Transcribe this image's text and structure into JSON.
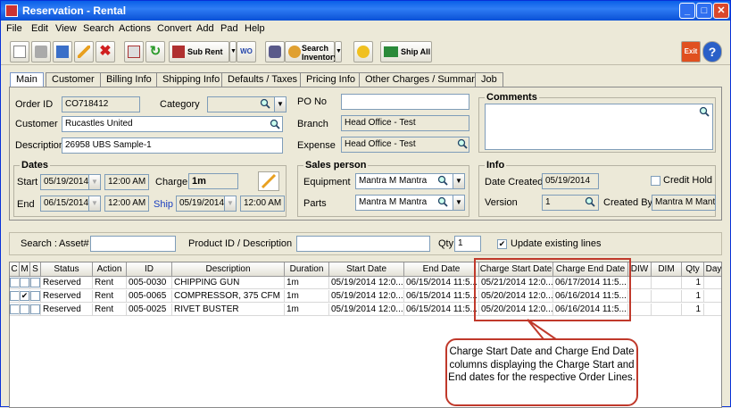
{
  "window": {
    "title": "Reservation - Rental"
  },
  "menu": [
    "File",
    "Edit",
    "View",
    "Search",
    "Actions",
    "Convert",
    "Add",
    "Pad",
    "Help"
  ],
  "toolbar": {
    "sub_rent": "Sub Rent",
    "wo": "WO",
    "search_inventory_1": "Search",
    "search_inventory_2": "Inventory",
    "ship_all": "Ship All",
    "exit": "Exit"
  },
  "tabs": [
    "Main",
    "Customer",
    "Billing Info",
    "Shipping Info",
    "Defaults / Taxes",
    "Pricing Info",
    "Other Charges / Summary",
    "Job"
  ],
  "main": {
    "order_id_label": "Order ID",
    "order_id": "CO718412",
    "category_label": "Category",
    "category": "",
    "customer_label": "Customer",
    "customer": "Rucastles United",
    "description_label": "Description",
    "description": "26958 UBS Sample-1",
    "po_no_label": "PO No",
    "po_no": "",
    "branch_label": "Branch",
    "branch": "Head Office - Test",
    "expense_label": "Expense",
    "expense": "Head Office - Test",
    "comments_label": "Comments",
    "dates_label": "Dates",
    "start_label": "Start",
    "start_date": "05/19/2014",
    "start_time": "12:00 AM",
    "charge_label": "Charge",
    "charge": "1m",
    "end_label": "End",
    "end_date": "06/15/2014",
    "end_time": "12:00 AM",
    "ship_label": "Ship",
    "ship_date": "05/19/2014",
    "ship_time": "12:00 AM",
    "sales_label": "Sales person",
    "equipment_label": "Equipment",
    "equipment": "Mantra M Mantra",
    "parts_label": "Parts",
    "parts": "Mantra M Mantra",
    "info_label": "Info",
    "date_created_label": "Date Created",
    "date_created": "05/19/2014",
    "credit_hold_label": "Credit Hold",
    "version_label": "Version",
    "version": "1",
    "created_by_label": "Created By",
    "created_by": "Mantra M Mantra"
  },
  "search": {
    "search_label": "Search :",
    "asset_label": "Asset#",
    "asset": "",
    "product_label": "Product ID / Description",
    "product": "",
    "qty_label": "Qty",
    "qty": "1",
    "update_label": "Update existing lines"
  },
  "grid": {
    "headers": [
      "C",
      "M",
      "S",
      "Status",
      "Action",
      "ID",
      "Description",
      "Duration",
      "Start Date",
      "End Date",
      "Charge Start Date",
      "Charge End Date",
      "DIW",
      "DIM",
      "Qty",
      "Day"
    ],
    "rows": [
      {
        "m": "",
        "status": "Reserved",
        "action": "Rent",
        "id": "005-0030",
        "desc": "CHIPPING GUN",
        "duration": "1m",
        "start": "05/19/2014 12:0...",
        "end": "06/15/2014 11:5...",
        "cstart": "05/21/2014 12:0...",
        "cend": "06/17/2014 11:5...",
        "qty": "1"
      },
      {
        "m": "✔",
        "status": "Reserved",
        "action": "Rent",
        "id": "005-0065",
        "desc": "COMPRESSOR, 375 CFM",
        "duration": "1m",
        "start": "05/19/2014 12:0...",
        "end": "06/15/2014 11:5...",
        "cstart": "05/20/2014 12:0...",
        "cend": "06/16/2014 11:5...",
        "qty": "1"
      },
      {
        "m": "",
        "status": "Reserved",
        "action": "Rent",
        "id": "005-0025",
        "desc": "RIVET BUSTER",
        "duration": "1m",
        "start": "05/19/2014 12:0...",
        "end": "06/15/2014 11:5...",
        "cstart": "05/20/2014 12:0...",
        "cend": "06/16/2014 11:5...",
        "qty": "1"
      }
    ]
  },
  "callout": {
    "text": "Charge Start Date and Charge End Date columns displaying the Charge Start and End dates for the respective Order Lines."
  }
}
